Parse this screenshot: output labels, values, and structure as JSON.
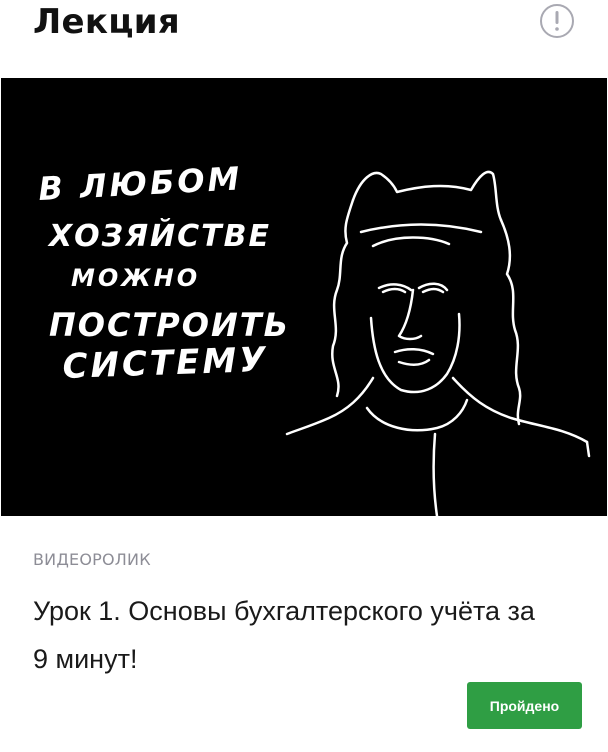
{
  "header": {
    "title": "Лекция",
    "info_icon": "info-circle-icon"
  },
  "video": {
    "overlay_text_lines": [
      "В ЛЮБОМ",
      "ХОЗЯЙСТВЕ",
      "МОЖНО",
      "ПОСТРОИТЬ",
      "СИСТЕМУ"
    ],
    "background_color": "#000000"
  },
  "content": {
    "type_label": "ВИДЕОРОЛИК",
    "lesson_title": "Урок 1. Основы бухгалтерского учёта за 9 минут!",
    "done_label": "Пройдено",
    "accent_color": "#2f9e44"
  }
}
